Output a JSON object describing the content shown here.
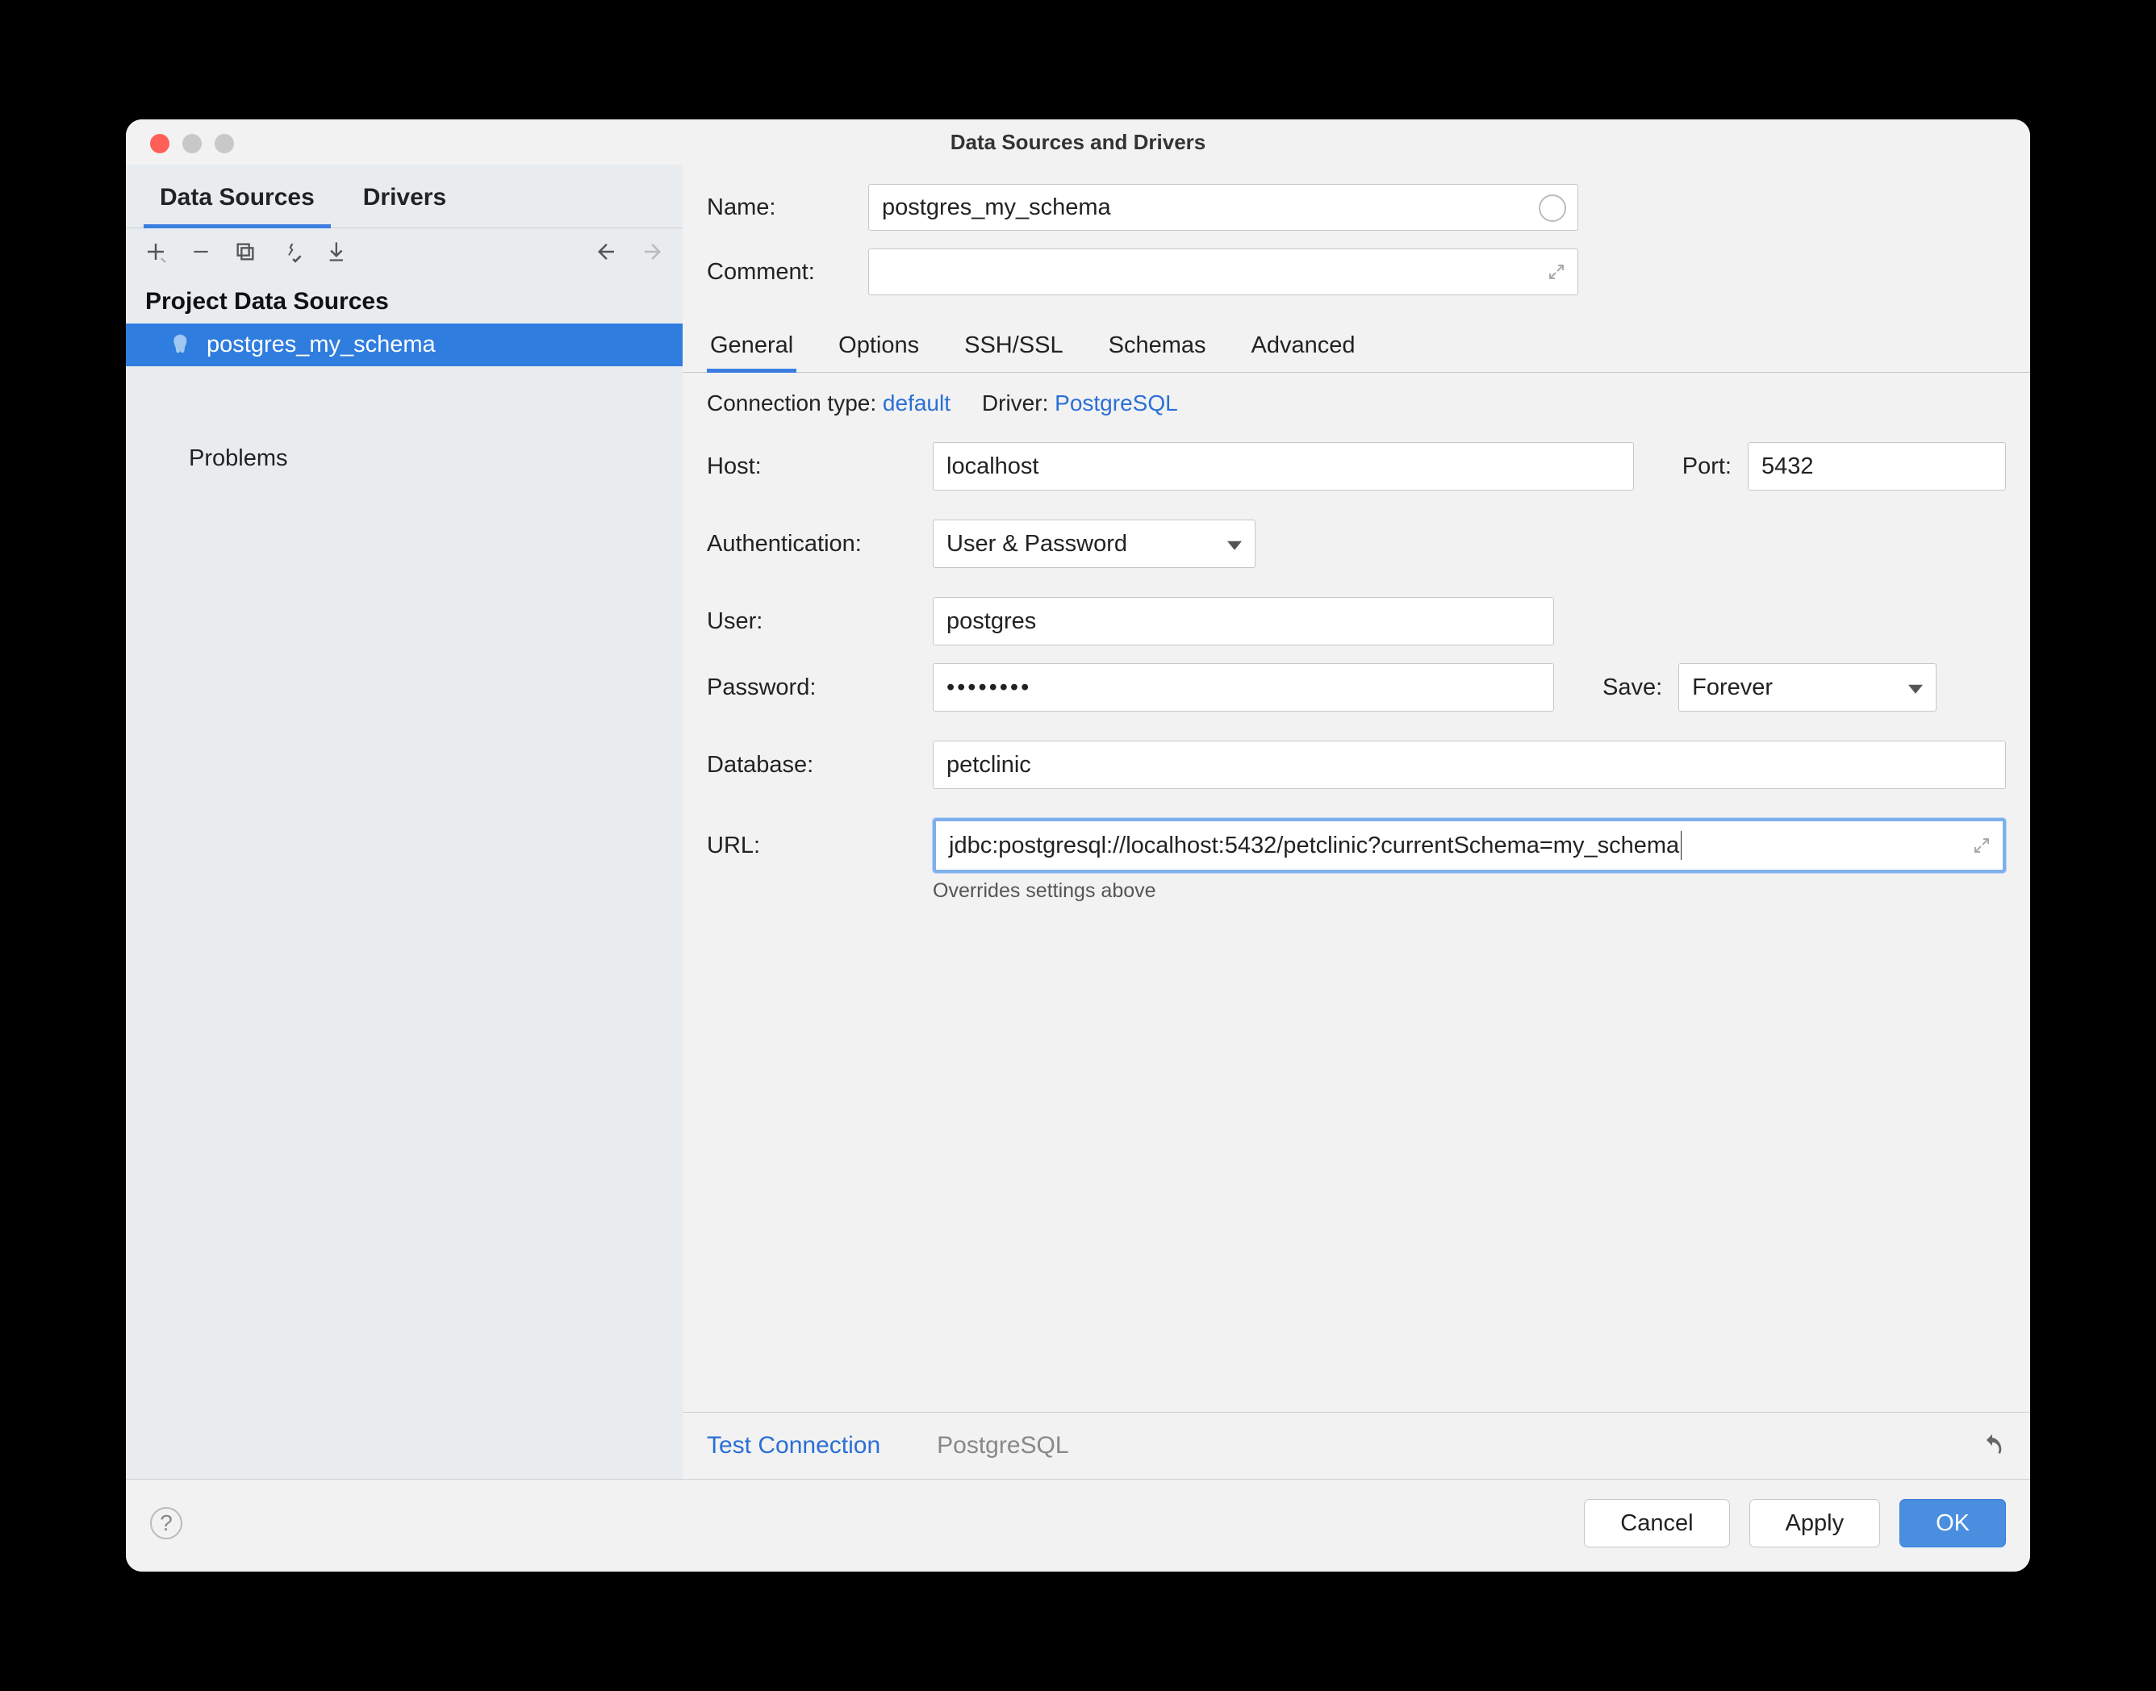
{
  "window": {
    "title": "Data Sources and Drivers"
  },
  "sidebar": {
    "tabs": {
      "dataSources": "Data Sources",
      "drivers": "Drivers"
    },
    "sectionTitle": "Project Data Sources",
    "items": [
      {
        "label": "postgres_my_schema"
      }
    ],
    "problems": "Problems"
  },
  "header": {
    "nameLabel": "Name:",
    "nameValue": "postgres_my_schema",
    "commentLabel": "Comment:"
  },
  "mainTabs": {
    "general": "General",
    "options": "Options",
    "sshssl": "SSH/SSL",
    "schemas": "Schemas",
    "advanced": "Advanced"
  },
  "connLine": {
    "typeLabel": "Connection type:",
    "typeValue": "default",
    "driverLabel": "Driver:",
    "driverValue": "PostgreSQL"
  },
  "form": {
    "hostLabel": "Host:",
    "hostValue": "localhost",
    "portLabel": "Port:",
    "portValue": "5432",
    "authLabel": "Authentication:",
    "authValue": "User & Password",
    "userLabel": "User:",
    "userValue": "postgres",
    "passwordLabel": "Password:",
    "passwordValue": "••••••••",
    "saveLabel": "Save:",
    "saveValue": "Forever",
    "databaseLabel": "Database:",
    "databaseValue": "petclinic",
    "urlLabel": "URL:",
    "urlValue": "jdbc:postgresql://localhost:5432/petclinic?currentSchema=my_schema",
    "urlHint": "Overrides settings above"
  },
  "testBar": {
    "test": "Test Connection",
    "driver": "PostgreSQL"
  },
  "footer": {
    "cancel": "Cancel",
    "apply": "Apply",
    "ok": "OK"
  }
}
